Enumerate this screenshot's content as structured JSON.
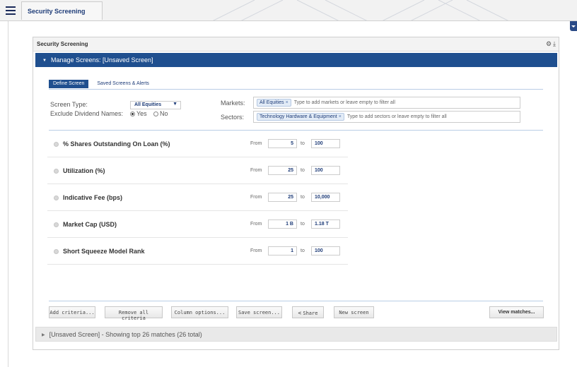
{
  "app": {
    "tab_title": "Security Screening"
  },
  "panel": {
    "title": "Security Screening",
    "settings_icon": "gear-icon",
    "download_icon": "download-icon"
  },
  "manage": {
    "label": "Manage Screens: [Unsaved Screen]"
  },
  "tabs": [
    {
      "label": "Define Screen",
      "active": true
    },
    {
      "label": "Saved Screens & Alerts",
      "active": false
    }
  ],
  "screen_type": {
    "label": "Screen Type:",
    "value": "All Equities"
  },
  "dividend": {
    "label": "Exclude Dividend Names:",
    "yes": "Yes",
    "no": "No",
    "selected": "Yes"
  },
  "markets": {
    "label": "Markets:",
    "token": "All Equities",
    "placeholder": "Type to add markets or leave empty to filter all"
  },
  "sectors": {
    "label": "Sectors:",
    "token": "Technology Hardware & Equipment",
    "placeholder": "Type to add sectors or leave empty to filter all"
  },
  "criteria": [
    {
      "name": "% Shares Outstanding On Loan (%)",
      "from_label": "From",
      "from": "5",
      "to_label": "to",
      "to": "100"
    },
    {
      "name": "Utilization (%)",
      "from_label": "From",
      "from": "25",
      "to_label": "to",
      "to": "100"
    },
    {
      "name": "Indicative Fee (bps)",
      "from_label": "From",
      "from": "25",
      "to_label": "to",
      "to": "10,000"
    },
    {
      "name": "Market Cap (USD)",
      "from_label": "From",
      "from": "1 B",
      "to_label": "to",
      "to": "1.18 T"
    },
    {
      "name": "Short Squeeze Model Rank",
      "from_label": "From",
      "from": "1",
      "to_label": "to",
      "to": "100"
    }
  ],
  "buttons": {
    "add": "Add criteria...",
    "remove": "Remove all criteria",
    "columns": "Column options...",
    "save": "Save screen...",
    "share": "Share",
    "new": "New screen",
    "view": "View matches..."
  },
  "results": {
    "label": "[Unsaved Screen] - Showing top 26 matches (26 total)"
  }
}
